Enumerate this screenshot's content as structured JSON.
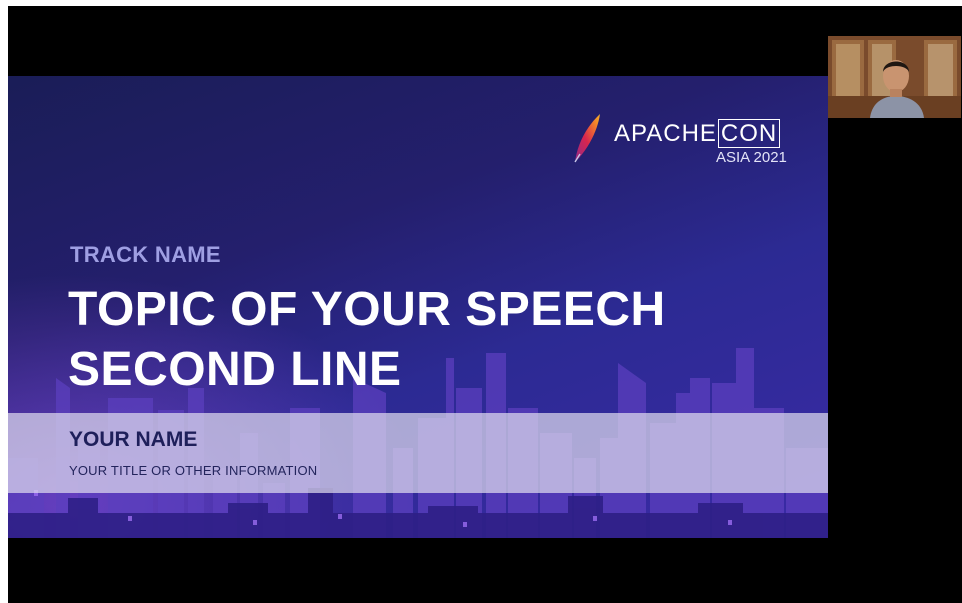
{
  "slide": {
    "track_name": "TRACK NAME",
    "title_lines": [
      "TOPIC OF YOUR SPEECH",
      "SECOND LINE"
    ],
    "speaker_name": "YOUR NAME",
    "speaker_info": "YOUR TITLE  OR OTHER INFORMATION",
    "brand": {
      "name_prefix": "APACHE",
      "name_boxed": "CON",
      "edition": "ASIA 2021",
      "logo_icon": "apache-feather-icon"
    }
  },
  "webcam": {
    "content": "presenter-video-feed"
  },
  "colors": {
    "background": "#000000",
    "slide_dark": "#1a1d57",
    "slide_light": "#3a2aa6",
    "accent_purple": "#9f9fe3",
    "band": "#e1def0",
    "speaker_text": "#1e1f5a"
  }
}
